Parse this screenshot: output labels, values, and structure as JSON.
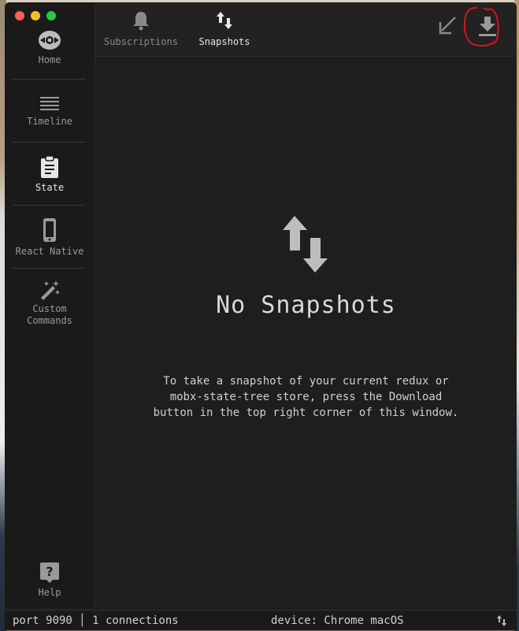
{
  "sidebar": {
    "items": [
      {
        "label": "Home",
        "icon": "home-icon",
        "active": false
      },
      {
        "label": "Timeline",
        "icon": "timeline-icon",
        "active": false
      },
      {
        "label": "State",
        "icon": "clipboard-icon",
        "active": true
      },
      {
        "label": "React Native",
        "icon": "phone-icon",
        "active": false
      },
      {
        "label": "Custom\nCommands",
        "icon": "magic-wand-icon",
        "active": false
      }
    ],
    "help_label": "Help"
  },
  "tabs": [
    {
      "label": "Subscriptions",
      "icon": "bell-icon",
      "active": false
    },
    {
      "label": "Snapshots",
      "icon": "arrows-up-down-icon",
      "active": true
    }
  ],
  "toolbar": {
    "import_icon": "arrow-down-left-icon",
    "download_icon": "download-icon"
  },
  "empty_state": {
    "title": "No Snapshots",
    "message": "To take a snapshot of your current redux or\nmobx-state-tree store, press the Download\nbutton in the top right corner of this window."
  },
  "status": {
    "connection": "port 9090 │ 1 connections",
    "device": "device: Chrome macOS"
  },
  "colors": {
    "background": "#1e1e1e",
    "sidebar": "#1a1a1a",
    "annotation": "#e0101a"
  }
}
